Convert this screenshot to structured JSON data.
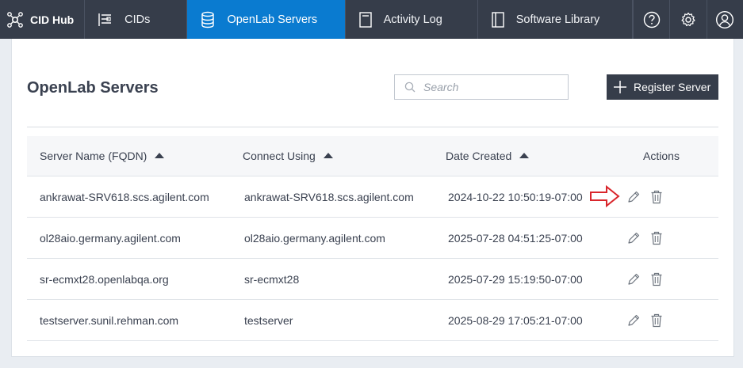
{
  "app": {
    "brand": "CID Hub"
  },
  "nav": {
    "items": [
      {
        "label": "CIDs",
        "icon": "cids-icon"
      },
      {
        "label": "OpenLab Servers",
        "icon": "database-icon",
        "active": true
      },
      {
        "label": "Activity Log",
        "icon": "log-icon"
      },
      {
        "label": "Software Library",
        "icon": "library-icon"
      }
    ],
    "right_icons": [
      "help-icon",
      "gear-icon",
      "user-icon"
    ]
  },
  "page": {
    "title": "OpenLab Servers",
    "search_placeholder": "Search",
    "register_label": "Register Server"
  },
  "table": {
    "headers": [
      "Server Name (FQDN)",
      "Connect Using",
      "Date Created",
      "Actions"
    ],
    "rows": [
      {
        "name": "ankrawat-SRV618.scs.agilent.com",
        "connect": "ankrawat-SRV618.scs.agilent.com",
        "date": "2024-10-22 10:50:19-07:00"
      },
      {
        "name": "ol28aio.germany.agilent.com",
        "connect": "ol28aio.germany.agilent.com",
        "date": "2025-07-28 04:51:25-07:00"
      },
      {
        "name": "sr-ecmxt28.openlabqa.org",
        "connect": "sr-ecmxt28",
        "date": "2025-07-29 15:19:50-07:00"
      },
      {
        "name": "testserver.sunil.rehman.com",
        "connect": "testserver",
        "date": "2025-08-29 17:05:21-07:00"
      }
    ]
  },
  "colors": {
    "topbar": "#363d4a",
    "active_tab": "#0a7bd0",
    "annotation": "#d9262c"
  }
}
